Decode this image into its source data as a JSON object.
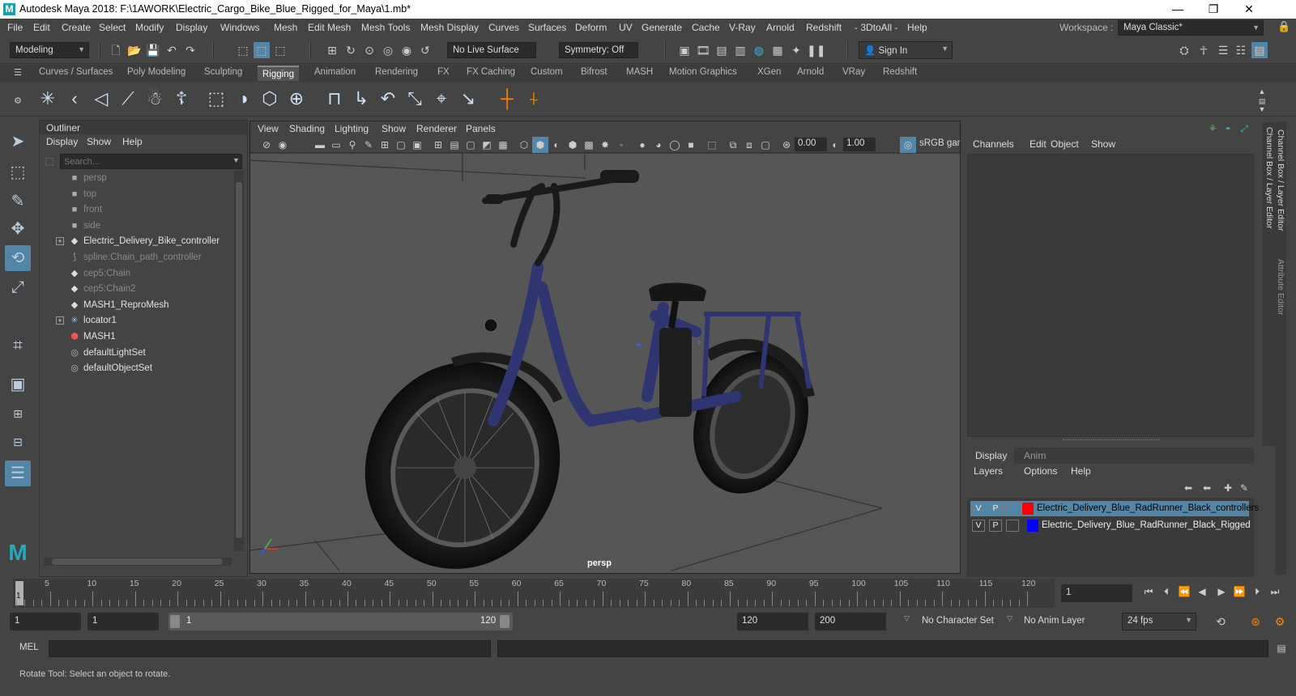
{
  "window": {
    "title": "Autodesk Maya 2018: F:\\1AWORK\\Electric_Cargo_Bike_Blue_Rigged_for_Maya\\1.mb*",
    "logo": "M",
    "minimize": "—",
    "maximize": "❐",
    "close": "✕"
  },
  "menu": [
    "File",
    "Edit",
    "Create",
    "Select",
    "Modify",
    "Display",
    "Windows",
    "Mesh",
    "Edit Mesh",
    "Mesh Tools",
    "Mesh Display",
    "Curves",
    "Surfaces",
    "Deform",
    "UV",
    "Generate",
    "Cache",
    "V-Ray",
    "Arnold",
    "Redshift",
    "- 3DtoAll -",
    "Help"
  ],
  "workspace": {
    "label": "Workspace :",
    "value": "Maya Classic*"
  },
  "status": {
    "mode": "Modeling",
    "live_surface": "No Live Surface",
    "symmetry": "Symmetry: Off",
    "sign_in": "Sign In"
  },
  "shelf_tabs": [
    "Curves / Surfaces",
    "Poly Modeling",
    "Sculpting",
    "Rigging",
    "Animation",
    "Rendering",
    "FX",
    "FX Caching",
    "Custom",
    "Bifrost",
    "MASH",
    "Motion Graphics",
    "XGen",
    "Arnold",
    "VRay",
    "Redshift"
  ],
  "shelf_active": "Rigging",
  "outliner": {
    "title": "Outliner",
    "menu": [
      "Display",
      "Show",
      "Help"
    ],
    "search_placeholder": "Search...",
    "items": [
      {
        "label": "persp",
        "icon": "camera-icon",
        "dim": true,
        "expand": false
      },
      {
        "label": "top",
        "icon": "camera-icon",
        "dim": true,
        "expand": false
      },
      {
        "label": "front",
        "icon": "camera-icon",
        "dim": true,
        "expand": false
      },
      {
        "label": "side",
        "icon": "camera-icon",
        "dim": true,
        "expand": false
      },
      {
        "label": "Electric_Delivery_Bike_controller",
        "icon": "transform-icon",
        "dim": false,
        "expand": true
      },
      {
        "label": "spline:Chain_path_controller",
        "icon": "curve-icon",
        "dim": true,
        "expand": false
      },
      {
        "label": "cep5:Chain",
        "icon": "transform-icon",
        "dim": true,
        "expand": false
      },
      {
        "label": "cep5:Chain2",
        "icon": "transform-icon",
        "dim": true,
        "expand": false
      },
      {
        "label": "MASH1_ReproMesh",
        "icon": "transform-icon",
        "dim": false,
        "expand": false
      },
      {
        "label": "locator1",
        "icon": "locator-icon",
        "dim": false,
        "expand": true
      },
      {
        "label": "MASH1",
        "icon": "mash-icon",
        "dim": false,
        "expand": false
      },
      {
        "label": "defaultLightSet",
        "icon": "set-icon",
        "dim": false,
        "expand": false
      },
      {
        "label": "defaultObjectSet",
        "icon": "set-icon",
        "dim": false,
        "expand": false
      }
    ]
  },
  "viewport": {
    "menu": [
      "View",
      "Shading",
      "Lighting",
      "Show",
      "Renderer",
      "Panels"
    ],
    "near": "0.00",
    "far": "1.00",
    "color_space": "sRGB gam",
    "camera_label": "persp"
  },
  "channel_box": {
    "menu": [
      "Channels",
      "Edit",
      "Object",
      "Show"
    ],
    "side_tab_1": "Channel Box / Layer Editor",
    "side_tab_2": "Attribute Editor"
  },
  "layer_editor": {
    "tabs": [
      "Display",
      "Anim"
    ],
    "menu": [
      "Layers",
      "Options",
      "Help"
    ],
    "layers": [
      {
        "v": "V",
        "p": "P",
        "color": "#ff0000",
        "name": "Electric_Delivery_Blue_RadRunner_Black_controllers",
        "selected": true
      },
      {
        "v": "V",
        "p": "P",
        "color": "#0000ff",
        "name": "Electric_Delivery_Blue_RadRunner_Black_Rigged",
        "selected": false
      }
    ]
  },
  "timeline": {
    "ticks": [
      "5",
      "10",
      "15",
      "20",
      "25",
      "30",
      "35",
      "40",
      "45",
      "50",
      "55",
      "60",
      "65",
      "70",
      "75",
      "80",
      "85",
      "90",
      "95",
      "100",
      "105",
      "110",
      "115",
      "120"
    ],
    "current_marker": "1",
    "current_frame": "1"
  },
  "range": {
    "start": "1",
    "playback_start": "1",
    "slider_start": "1",
    "slider_end": "120",
    "playback_end": "120",
    "end": "200",
    "character_set": "No Character Set",
    "anim_layer": "No Anim Layer",
    "fps": "24 fps"
  },
  "mel": {
    "label": "MEL"
  },
  "help_line": "Rotate Tool: Select an object to rotate."
}
